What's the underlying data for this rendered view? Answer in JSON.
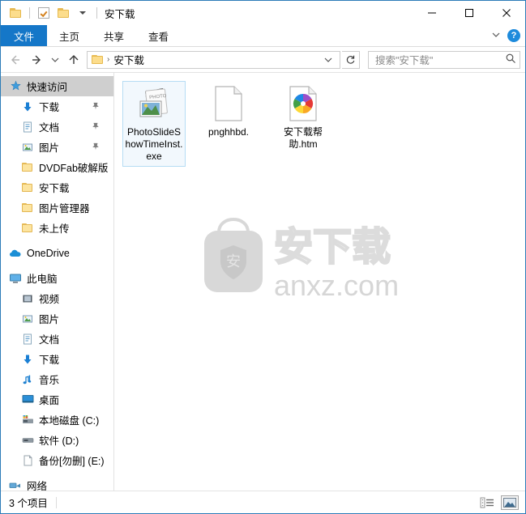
{
  "window": {
    "title": "安下载",
    "quick_access_toolbar": [
      {
        "name": "folder-icon",
        "label": "安下载"
      },
      {
        "name": "properties-icon",
        "label": "属性"
      },
      {
        "name": "new-folder-icon",
        "label": "新建文件夹"
      },
      {
        "name": "customize-caret-icon",
        "label": "自定义快速访问工具栏"
      }
    ],
    "controls": {
      "minimize": "最小化",
      "maximize": "最大化",
      "close": "关闭"
    }
  },
  "ribbon": {
    "tabs": [
      {
        "label": "文件",
        "active": true
      },
      {
        "label": "主页",
        "active": false
      },
      {
        "label": "共享",
        "active": false
      },
      {
        "label": "查看",
        "active": false
      }
    ],
    "collapse_label": "展开功能区",
    "help_label": "?"
  },
  "addressbar": {
    "back_label": "后退",
    "forward_label": "前进",
    "recent_label": "最近浏览的位置",
    "up_label": "上移到",
    "breadcrumbs": [
      "安下载"
    ],
    "separator": "›",
    "dropdown_label": "历史记录",
    "refresh_label": "刷新"
  },
  "search": {
    "placeholder": "搜索\"安下载\""
  },
  "sidebar": {
    "items": [
      {
        "label": "快速访问",
        "icon": "star-pin-icon",
        "selected": true,
        "indent": 0,
        "pinned": false
      },
      {
        "label": "下载",
        "icon": "download-icon",
        "selected": false,
        "indent": 1,
        "pinned": true
      },
      {
        "label": "文档",
        "icon": "documents-icon",
        "selected": false,
        "indent": 1,
        "pinned": true
      },
      {
        "label": "图片",
        "icon": "pictures-icon",
        "selected": false,
        "indent": 1,
        "pinned": true
      },
      {
        "label": "DVDFab破解版",
        "icon": "folder-icon",
        "selected": false,
        "indent": 1,
        "pinned": false
      },
      {
        "label": "安下载",
        "icon": "folder-icon",
        "selected": false,
        "indent": 1,
        "pinned": false
      },
      {
        "label": "图片管理器",
        "icon": "folder-icon",
        "selected": false,
        "indent": 1,
        "pinned": false
      },
      {
        "label": "未上传",
        "icon": "folder-icon",
        "selected": false,
        "indent": 1,
        "pinned": false
      },
      {
        "label": "OneDrive",
        "icon": "onedrive-cloud-icon",
        "selected": false,
        "indent": 0,
        "pinned": false
      },
      {
        "label": "此电脑",
        "icon": "this-pc-icon",
        "selected": false,
        "indent": 0,
        "pinned": false
      },
      {
        "label": "视频",
        "icon": "videos-icon",
        "selected": false,
        "indent": 1,
        "pinned": false
      },
      {
        "label": "图片",
        "icon": "pictures-icon",
        "selected": false,
        "indent": 1,
        "pinned": false
      },
      {
        "label": "文档",
        "icon": "documents-icon",
        "selected": false,
        "indent": 1,
        "pinned": false
      },
      {
        "label": "下载",
        "icon": "download-icon",
        "selected": false,
        "indent": 1,
        "pinned": false
      },
      {
        "label": "音乐",
        "icon": "music-icon",
        "selected": false,
        "indent": 1,
        "pinned": false
      },
      {
        "label": "桌面",
        "icon": "desktop-icon",
        "selected": false,
        "indent": 1,
        "pinned": false
      },
      {
        "label": "本地磁盘 (C:)",
        "icon": "windows-drive-icon",
        "selected": false,
        "indent": 1,
        "pinned": false
      },
      {
        "label": "软件 (D:)",
        "icon": "drive-icon",
        "selected": false,
        "indent": 1,
        "pinned": false
      },
      {
        "label": "备份[勿删] (E:)",
        "icon": "drive-icon",
        "selected": false,
        "indent": 1,
        "pinned": false
      },
      {
        "label": "网络",
        "icon": "network-icon",
        "selected": false,
        "indent": 0,
        "pinned": false
      }
    ]
  },
  "files": [
    {
      "name": "PhotoSlideShowTimeInst.exe",
      "icon": "photo-slideshow-exe-icon",
      "selected": true
    },
    {
      "name": "pnghhbd.",
      "icon": "blank-file-icon",
      "selected": false
    },
    {
      "name": "安下载帮助.htm",
      "icon": "html-pinwheel-icon",
      "selected": false
    }
  ],
  "watermark": {
    "logo_char": "安",
    "title": "安下载",
    "domain": "anxz.com"
  },
  "statusbar": {
    "item_count": "3 个项目",
    "views": [
      {
        "name": "details-view-button",
        "label": "详细信息",
        "active": false
      },
      {
        "name": "large-icons-view-button",
        "label": "大图标",
        "active": true
      }
    ]
  },
  "colors": {
    "accent": "#1577c8",
    "window_border": "#2b7cb8",
    "selection_bg": "#f2f8fd",
    "selection_border": "#b6dcf4",
    "folder_yellow": "#fcdd8c",
    "nav_selected": "#cfcfcf"
  }
}
